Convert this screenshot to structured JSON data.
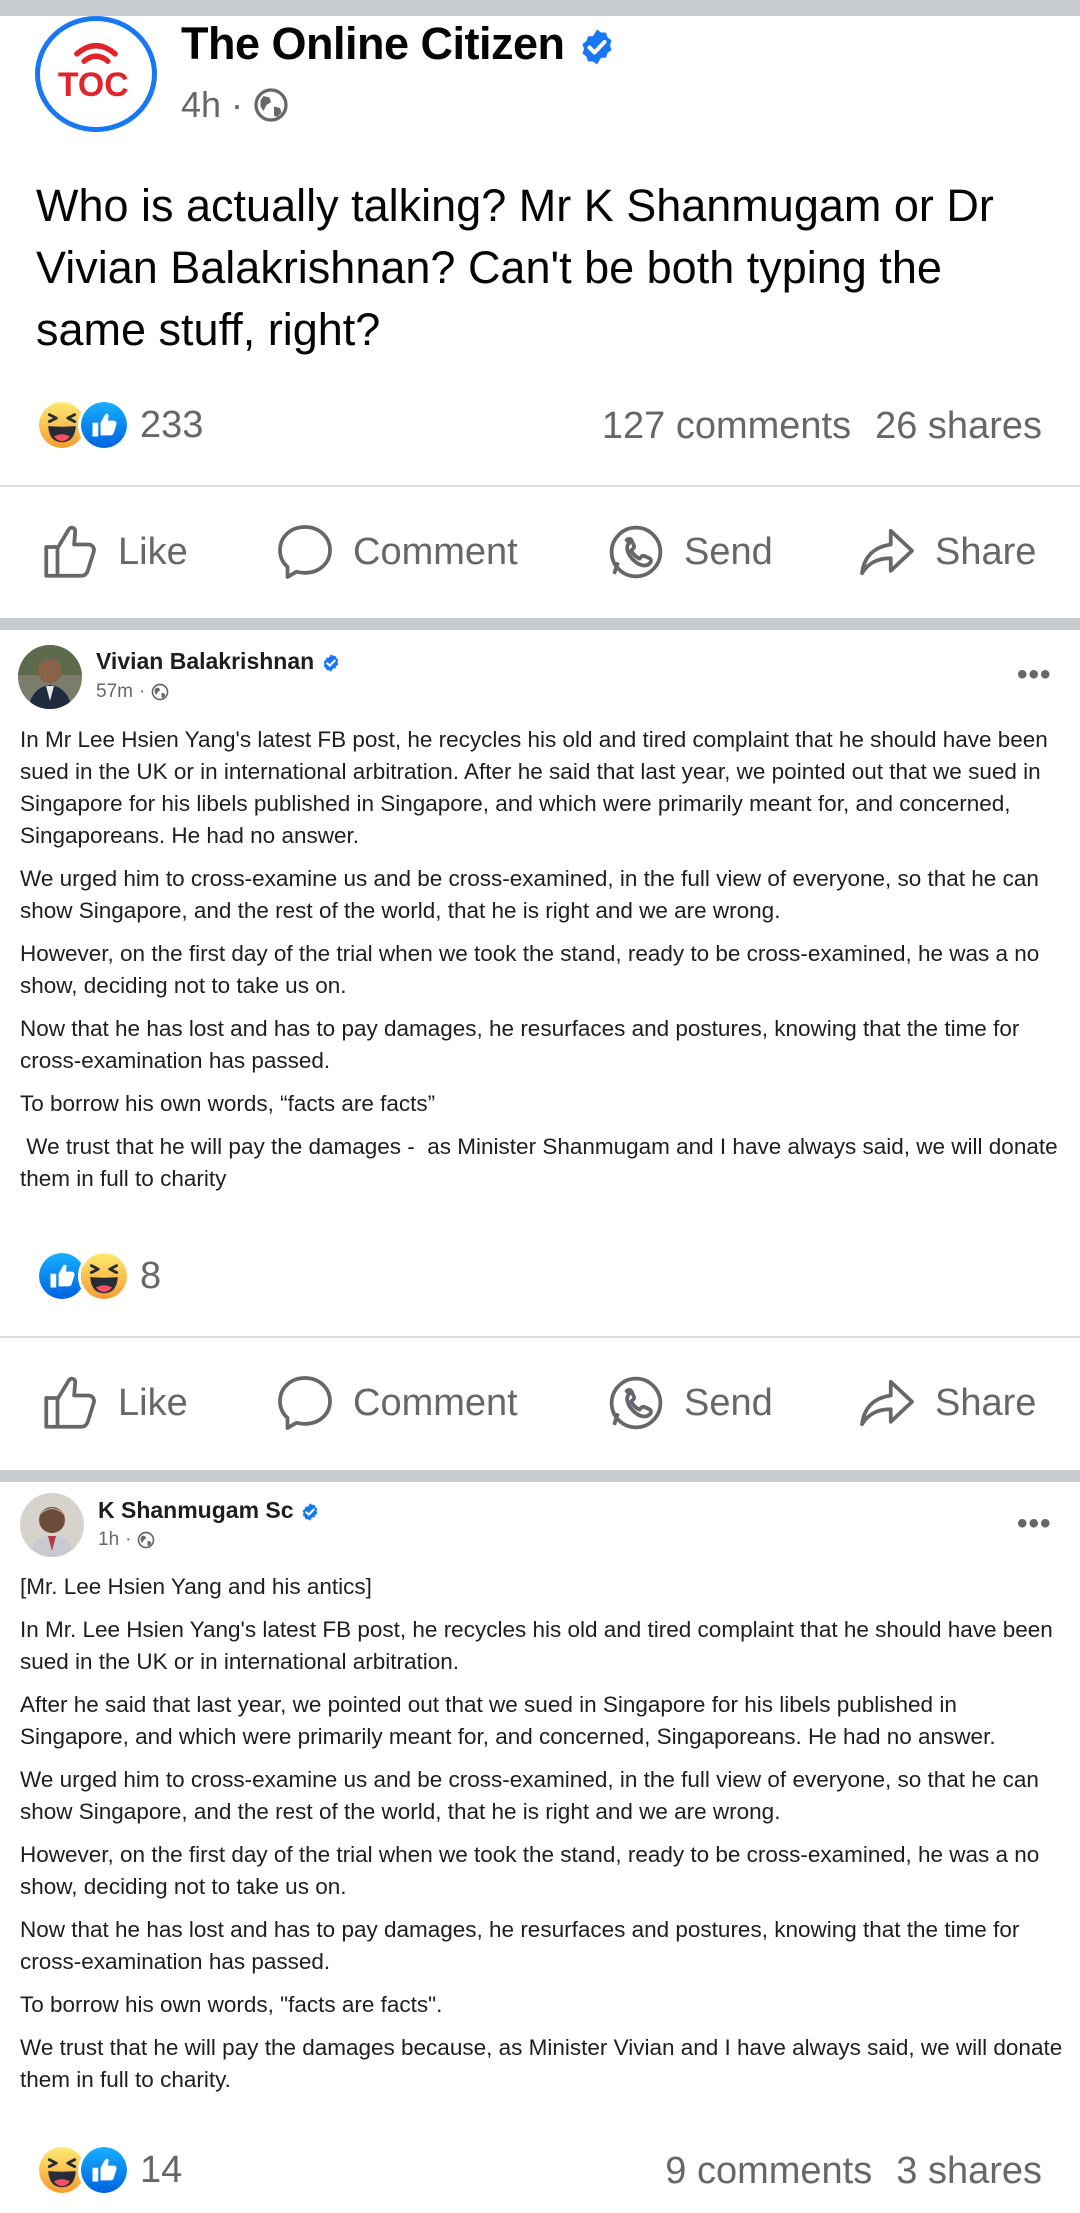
{
  "main_post": {
    "page_name": "The Online Citizen",
    "logo_text": "TOC",
    "time": "4h",
    "separator": "·",
    "text": "Who is actually talking? Mr K Shanmugam or Dr Vivian Balakrishnan? Can't be both typing the same stuff, right?",
    "reaction_count": "233",
    "comments": "127 comments",
    "shares": "26 shares",
    "actions": {
      "like": "Like",
      "comment": "Comment",
      "send": "Send",
      "share": "Share"
    }
  },
  "shared_post_1": {
    "author": "Vivian Balakrishnan",
    "time": "57m",
    "paragraphs": [
      "In Mr Lee Hsien Yang's latest FB post, he recycles his old and tired complaint that he should have been sued in the UK or in international arbitration. After he said that last year, we pointed out that we sued in Singapore for his libels published in Singapore, and which were primarily meant for, and concerned, Singaporeans. He had no answer.",
      "We urged him to cross-examine us and be cross-examined, in the full view of everyone, so that he can show Singapore, and the rest of the world, that he is right and we are wrong.",
      "However, on the first day of the trial when we took the stand, ready to be cross-examined, he was a no show, deciding not to take us on.",
      "Now that he has lost and has to pay damages, he resurfaces and postures, knowing that the time for cross-examination has passed.",
      "To borrow his own words,  “facts are facts”",
      " We trust that he will pay the damages -  as Minister Shanmugam and I have always said, we will donate them in full to charity"
    ],
    "reaction_count": "8",
    "actions": {
      "like": "Like",
      "comment": "Comment",
      "send": "Send",
      "share": "Share"
    }
  },
  "shared_post_2": {
    "author": "K Shanmugam Sc",
    "time": "1h",
    "paragraphs": [
      "[Mr. Lee Hsien Yang and his antics]",
      "In Mr. Lee Hsien Yang's latest FB post, he recycles his old and tired complaint that he should have been sued in the UK or in international arbitration.",
      "After he said that last year, we pointed out that we sued in Singapore for his libels published in Singapore, and which were primarily meant for, and concerned, Singaporeans. He had no answer.",
      "We urged him to cross-examine us and be cross-examined, in the full view of everyone, so that he can show Singapore, and the rest of the world, that he is right and we are wrong.",
      "However, on the first day of the trial when we took the stand, ready to be cross-examined, he was a no show, deciding not to take us on.",
      "Now that he has lost and has to pay damages, he resurfaces and postures, knowing that the time for cross-examination has passed.",
      "To borrow his own words, \"facts are facts\".",
      "We trust that he will pay the damages because, as Minister Vivian and I have always said, we will donate them in full to charity."
    ],
    "reaction_count": "14",
    "comments": "9 comments",
    "shares": "3 shares"
  },
  "icons": [
    "verified-badge-icon",
    "globe-icon",
    "haha-reaction-icon",
    "like-reaction-icon",
    "like-icon",
    "comment-icon",
    "send-icon",
    "share-icon",
    "more-options-icon"
  ],
  "colors": {
    "facebook_blue": "#1877f2",
    "haha_yellow": "#f7b125",
    "muted_text": "#65676b",
    "toc_red": "#e0242b"
  }
}
